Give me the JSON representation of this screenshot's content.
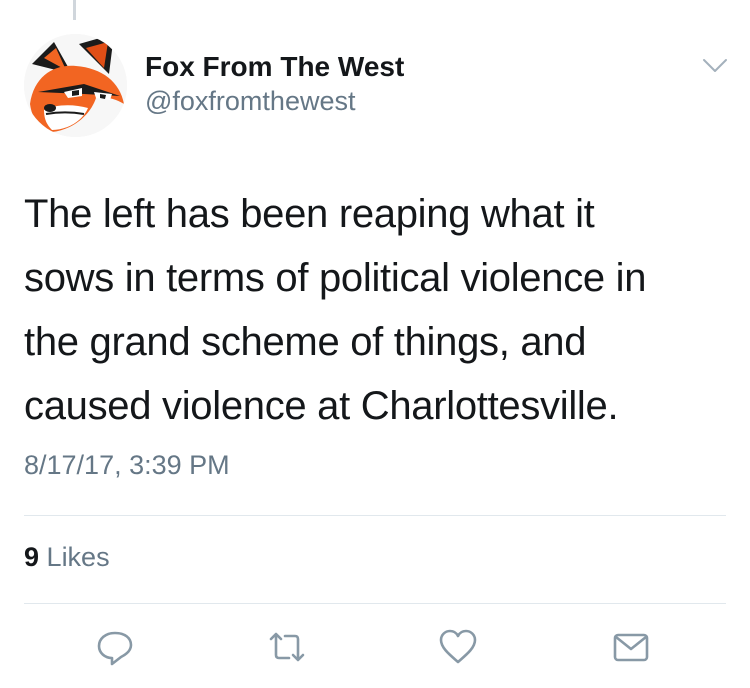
{
  "tweet": {
    "author": {
      "display_name": "Fox From The West",
      "handle": "@foxfromthewest",
      "avatar_icon": "fox-avatar"
    },
    "text_lines": [
      "The left has been reaping what it",
      "sows in terms of political violence in",
      "the grand scheme of things, and",
      "caused violence at Charlottesville."
    ],
    "timestamp": "8/17/17, 3:39 PM",
    "likes": {
      "count": "9",
      "label": "Likes"
    },
    "actions": [
      {
        "name": "reply",
        "icon": "reply-icon"
      },
      {
        "name": "retweet",
        "icon": "retweet-icon"
      },
      {
        "name": "like",
        "icon": "heart-icon"
      },
      {
        "name": "direct-message",
        "icon": "envelope-icon"
      }
    ],
    "menu_icon": "chevron-down-icon"
  },
  "colors": {
    "text_primary": "#14171a",
    "text_secondary": "#657786",
    "icon_gray": "#8899a6",
    "divider": "#e1e8ed",
    "fox_orange": "#f26522"
  }
}
